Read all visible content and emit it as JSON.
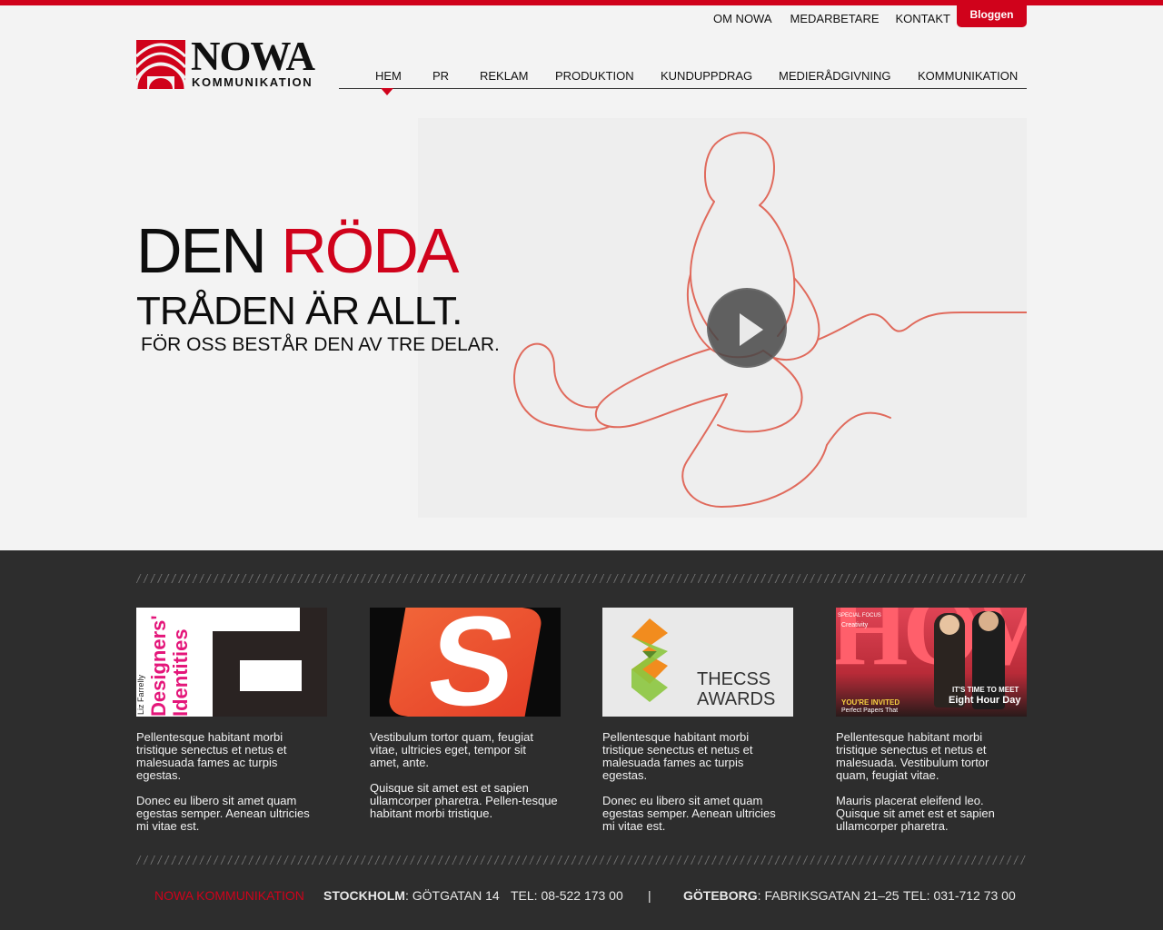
{
  "brand": {
    "logo_word": "NOWA",
    "logo_sub": "KOMMUNIKATION",
    "accent_color": "#d0021b"
  },
  "top_nav": {
    "items": [
      "OM NOWA",
      "MEDARBETARE",
      "KONTAKT"
    ],
    "blog_label": "Bloggen"
  },
  "main_nav": {
    "items": [
      "HEM",
      "PR",
      "REKLAM",
      "PRODUKTION",
      "KUNDUPPDRAG",
      "MEDIERÅDGIVNING",
      "KOMMUNIKATION"
    ],
    "active": "HEM"
  },
  "hero": {
    "line1_a": "DEN ",
    "line1_b": "RÖDA",
    "line2": "TRÅDEN ÄR ALLT.",
    "line3": "FÖR OSS BESTÅR DEN AV TRE DELAR.",
    "play_icon": "play-icon"
  },
  "cards": [
    {
      "thumb_text_1": "Designers'",
      "thumb_text_2": "Identities",
      "thumb_text_3": "Liz Farrelly",
      "p1": "Pellentesque habitant morbi tristique senectus et netus et malesuada fames ac turpis egestas.",
      "p2": "Donec eu libero sit amet quam egestas semper. Aenean ultricies mi vitae est."
    },
    {
      "thumb_text_1": "S",
      "p1": "Vestibulum tortor quam, feugiat vitae, ultricies eget, tempor sit amet, ante.",
      "p2": "Quisque sit amet est et sapien ullamcorper pharetra. Pellen-tesque habitant morbi tristique."
    },
    {
      "thumb_text_1": "THECSS",
      "thumb_text_2": "AWARDS",
      "p1": "Pellentesque habitant morbi tristique senectus et netus et malesuada fames ac turpis egestas.",
      "p2": "Donec eu libero sit amet quam egestas semper. Aenean ultricies mi vitae est."
    },
    {
      "thumb_text_1": "HOW",
      "thumb_text_2": "IT'S TIME TO MEET",
      "thumb_text_3": "Eight Hour Day",
      "thumb_text_4": "YOU'RE INVITED",
      "thumb_text_5": "Perfect Papers That",
      "thumb_text_6": "SPECIAL FOCUS",
      "thumb_text_7": "Creativity",
      "p1": "Pellentesque habitant morbi tristique senectus et netus et malesuada. Vestibulum tortor quam, feugiat vitae.",
      "p2": "Mauris placerat eleifend leo. Quisque sit amet est et sapien ullamcorper pharetra."
    }
  ],
  "footer": {
    "brand": "NOWA KOMMUNIKATION",
    "stockholm_label": "STOCKHOLM",
    "stockholm_addr": ": GÖTGATAN 14",
    "stockholm_tel": "TEL: 08-522 173 00",
    "divider": "|",
    "goteborg_label": "GÖTEBORG",
    "goteborg_addr": ": FABRIKSGATAN 21–25",
    "goteborg_tel": "TEL: 031-712 73 00"
  }
}
